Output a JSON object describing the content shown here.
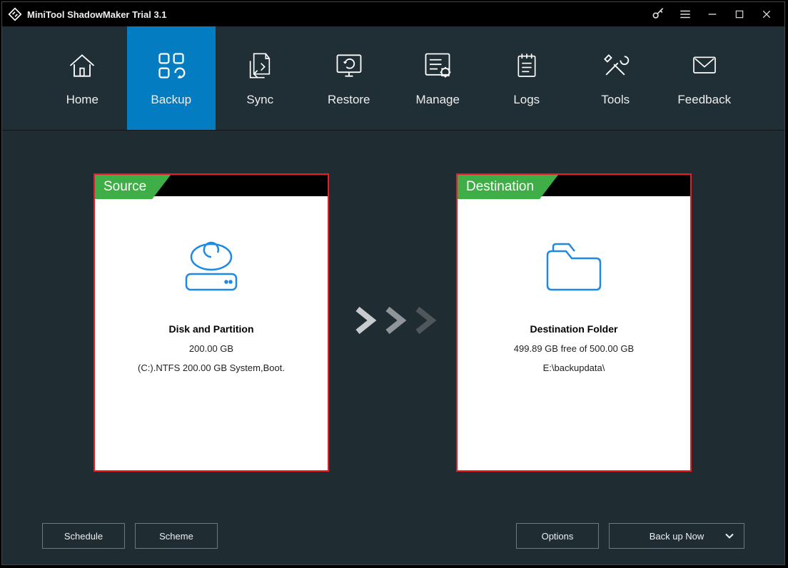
{
  "title": "MiniTool ShadowMaker Trial 3.1",
  "nav": {
    "items": [
      {
        "label": "Home"
      },
      {
        "label": "Backup"
      },
      {
        "label": "Sync"
      },
      {
        "label": "Restore"
      },
      {
        "label": "Manage"
      },
      {
        "label": "Logs"
      },
      {
        "label": "Tools"
      },
      {
        "label": "Feedback"
      }
    ],
    "activeIndex": 1
  },
  "source": {
    "tab": "Source",
    "title": "Disk and Partition",
    "size": "200.00 GB",
    "detail": "(C:).NTFS 200.00 GB System,Boot."
  },
  "destination": {
    "tab": "Destination",
    "title": "Destination Folder",
    "free": "499.89 GB free of 500.00 GB",
    "path": "E:\\backupdata\\"
  },
  "buttons": {
    "schedule": "Schedule",
    "scheme": "Scheme",
    "options": "Options",
    "backup": "Back up Now"
  }
}
